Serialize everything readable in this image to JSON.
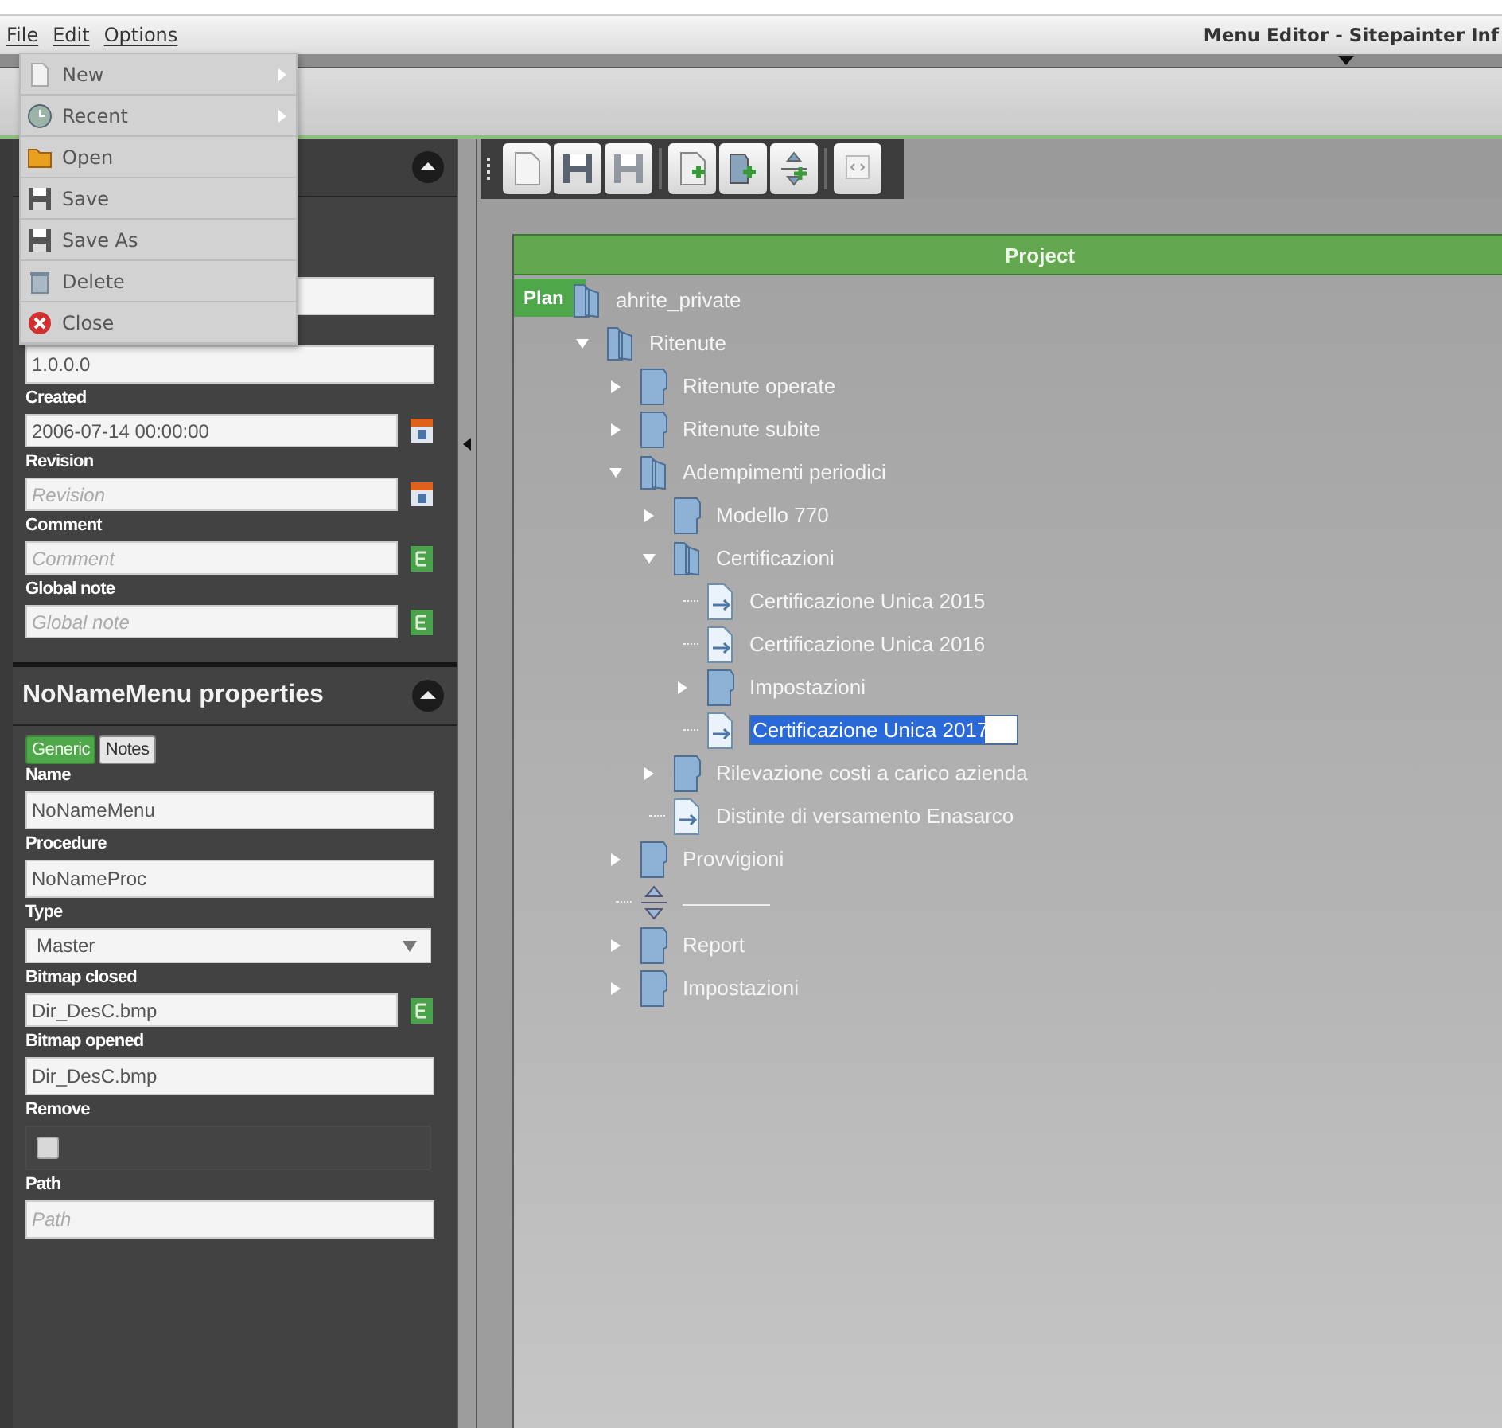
{
  "menubar": {
    "items": [
      "File",
      "Edit",
      "Options"
    ],
    "title": "Menu Editor - Sitepainter Inf"
  },
  "file_menu": [
    {
      "label": "New",
      "submenu": true
    },
    {
      "label": "Recent",
      "submenu": true
    },
    {
      "label": "Open",
      "submenu": false
    },
    {
      "label": "Save",
      "submenu": false
    },
    {
      "label": "Save As",
      "submenu": false
    },
    {
      "label": "Delete",
      "submenu": false
    },
    {
      "label": "Close",
      "submenu": false
    }
  ],
  "project_panel": {
    "fields": [
      {
        "kind": "text"
      },
      {
        "kind": "text",
        "value": "1.0.0.0"
      },
      {
        "kind": "date",
        "label": "Created",
        "value": "2006-07-14 00:00:00"
      },
      {
        "kind": "date",
        "label": "Revision",
        "placeholder": "Revision"
      },
      {
        "kind": "editor",
        "label": "Comment",
        "placeholder": "Comment"
      },
      {
        "kind": "editor",
        "label": "Global note",
        "placeholder": "Global note"
      }
    ]
  },
  "menu_panel": {
    "title": "NoNameMenu properties",
    "tabs": [
      {
        "label": "Generic",
        "selected": true
      },
      {
        "label": "Notes",
        "selected": false
      }
    ],
    "fields": [
      {
        "kind": "text",
        "label": "Name",
        "value": "NoNameMenu"
      },
      {
        "kind": "text",
        "label": "Procedure",
        "value": "NoNameProc"
      },
      {
        "kind": "select",
        "label": "Type",
        "value": "Master"
      },
      {
        "kind": "editor",
        "label": "Bitmap closed",
        "value": "Dir_DesC.bmp"
      },
      {
        "kind": "text",
        "label": "Bitmap opened",
        "value": "Dir_DesC.bmp"
      },
      {
        "kind": "checkbox",
        "label": "Remove",
        "checked": false
      },
      {
        "kind": "text",
        "label": "Path",
        "placeholder": "Path"
      }
    ]
  },
  "tree": {
    "header": "Project",
    "drag_badge": "Plan",
    "root": {
      "label": "ahrite_private",
      "kind": "folder",
      "expanded": true,
      "selected": false,
      "children": [
        {
          "label": "Ritenute",
          "kind": "folder",
          "expanded": true,
          "selected": false,
          "children": [
            {
              "label": "Ritenute operate",
              "kind": "folder",
              "expanded": false,
              "selected": false
            },
            {
              "label": "Ritenute subite",
              "kind": "folder",
              "expanded": false,
              "selected": false
            },
            {
              "label": "Adempimenti periodici",
              "kind": "folder",
              "expanded": true,
              "selected": false,
              "children": [
                {
                  "label": "Modello 770",
                  "kind": "folder",
                  "expanded": false,
                  "selected": false
                },
                {
                  "label": "Certificazioni",
                  "kind": "folder",
                  "expanded": true,
                  "selected": false,
                  "children": [
                    {
                      "label": "Certificazione Unica 2015",
                      "kind": "page",
                      "selected": false
                    },
                    {
                      "label": "Certificazione Unica 2016",
                      "kind": "page",
                      "selected": false
                    },
                    {
                      "label": "Impostazioni",
                      "kind": "folder",
                      "expanded": false,
                      "selected": false
                    },
                    {
                      "label": "Certificazione Unica 2017",
                      "kind": "page",
                      "selected": true
                    }
                  ]
                },
                {
                  "label": "Rilevazione costi a carico azienda",
                  "kind": "folder",
                  "expanded": false,
                  "selected": false
                },
                {
                  "label": "Distinte di versamento Enasarco",
                  "kind": "page",
                  "selected": false
                }
              ]
            },
            {
              "label": "Provvigioni",
              "kind": "folder",
              "expanded": false,
              "selected": false
            },
            {
              "kind": "separator",
              "selected": false
            },
            {
              "label": "Report",
              "kind": "folder",
              "expanded": false,
              "selected": false
            },
            {
              "label": "Impostazioni",
              "kind": "folder",
              "expanded": false,
              "selected": false
            }
          ]
        }
      ]
    }
  }
}
